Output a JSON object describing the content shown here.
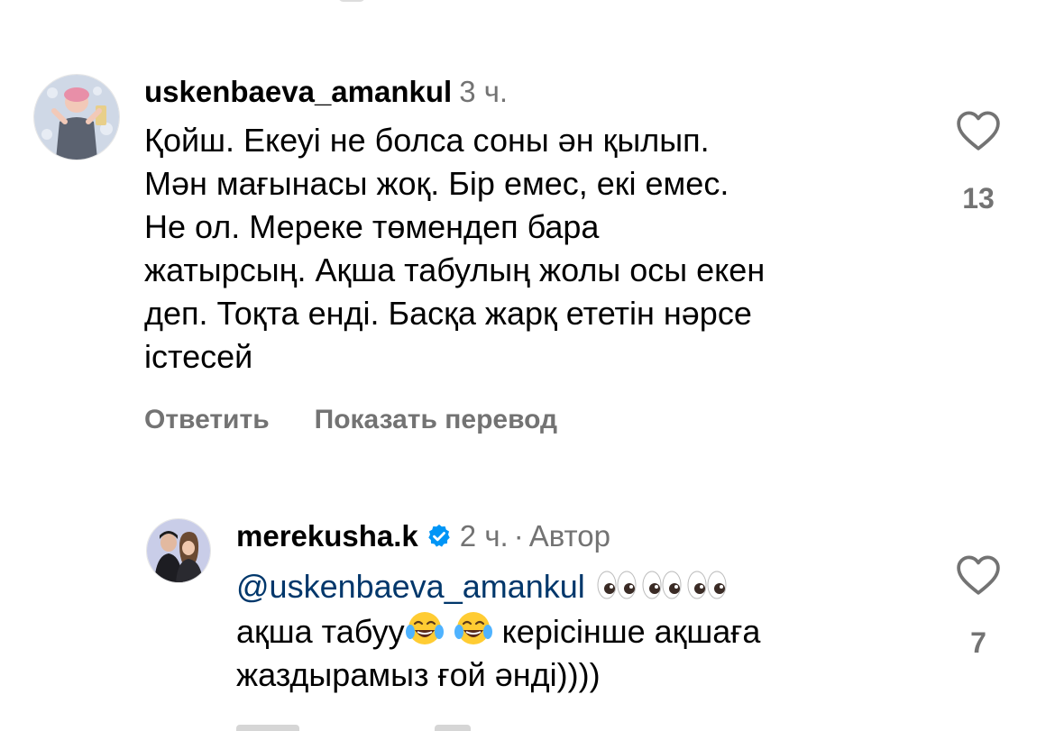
{
  "comments": [
    {
      "username": "uskenbaeva_amankul",
      "time": "3 ч.",
      "text_lines": [
        "Қойш. Екеуі не болса соны ән қылып.",
        "Мән мағынасы жоқ. Бір емес, екі емес.",
        "Не ол. Мереке төмендеп бара",
        "жатырсың. Ақша табулың жолы осы екен",
        "деп. Тоқта енді. Басқа жарқ ететін нәрсе",
        "істесей"
      ],
      "reply_label": "Ответить",
      "translate_label": "Показать перевод",
      "likes": "13"
    },
    {
      "username": "merekusha.k",
      "time": "2 ч.",
      "separator": "·",
      "author_label": "Автор",
      "mention": "@uskenbaeva_amankul",
      "line2_a": "ақша табуу",
      "line2_b": "керісінше ақшаға",
      "line3": "жаздырамыз ғой әнді))))",
      "likes": "7"
    }
  ],
  "icons": {
    "like": "heart-outline-icon",
    "verified": "verified-badge-icon",
    "eyes": "eyes-emoji-icon",
    "laugh": "tears-of-joy-emoji-icon"
  },
  "colors": {
    "secondary_text": "#737373",
    "mention": "#00376b",
    "verified": "#0095f6"
  }
}
